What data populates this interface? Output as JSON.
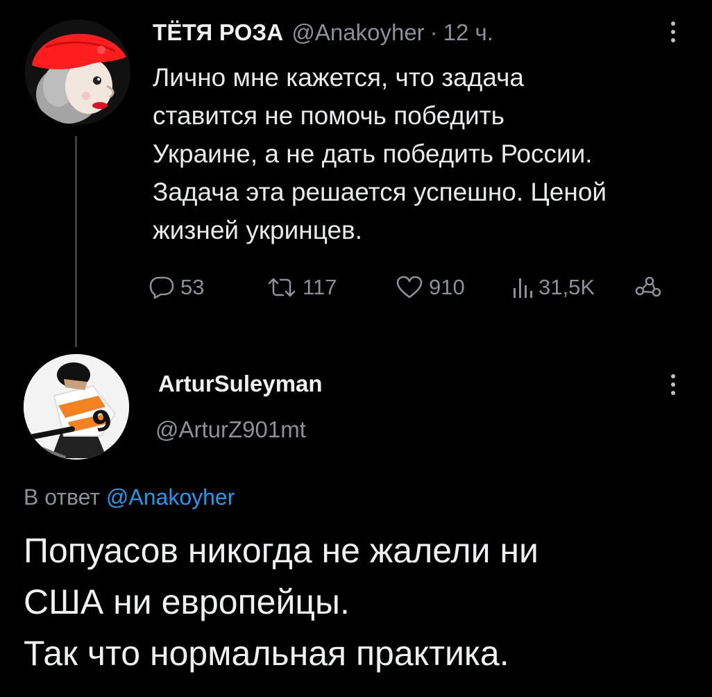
{
  "parent_tweet": {
    "display_name": "ТЁТЯ РОЗА",
    "handle": "@Anakoyher",
    "separator": "·",
    "time": "12 ч.",
    "text_lines": [
      "Лично мне кажется, что задача",
      "ставится не помочь победить",
      "Украине, а не дать победить России.",
      "Задача эта решается успешно. Ценой",
      "жизней укринцев."
    ],
    "stats": {
      "replies": "53",
      "retweets": "117",
      "likes": "910",
      "views": "31,5K"
    }
  },
  "reply_tweet": {
    "display_name": "ArturSuleyman",
    "handle": "@ArturZ901mt",
    "reply_to_prefix": "В ответ",
    "reply_to_handle": "@Anakoyher",
    "text_lines": [
      "Попуасов никогда не жалели ни",
      "США ни европейцы.",
      "Так что нормальная практика."
    ]
  },
  "colors": {
    "background": "#000000",
    "text": "#e7e9ea",
    "secondary": "#8b9196",
    "link": "#1d9bf0"
  },
  "icons": [
    "more-vertical-icon",
    "reply-icon",
    "retweet-icon",
    "like-icon",
    "views-icon",
    "share-icon"
  ]
}
